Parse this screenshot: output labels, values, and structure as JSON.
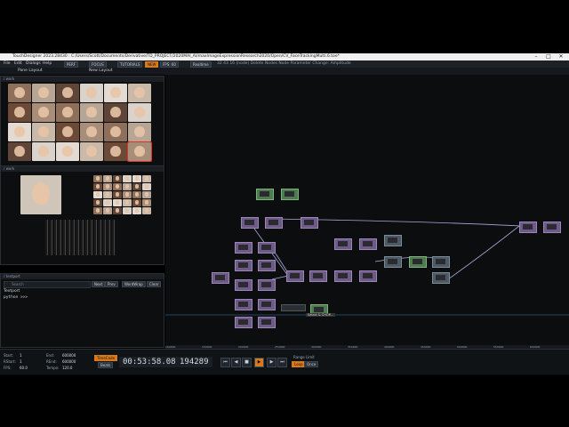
{
  "window": {
    "title": "TouchDesigner 2023.28430 : C:/Users/Scott/Documents/Derivative/TD_PROJECT/2020MAI_AI/maxImageExpressionResearch2020/Open/CV_FaceTrackingMulti.6.toe*",
    "min": "–",
    "max": "□",
    "close": "✕"
  },
  "menu": {
    "items": [
      "File",
      "Edit",
      "Dialogs",
      "Help"
    ],
    "pills": [
      "PERF",
      "FOCUS",
      "TUTORIALS",
      "NEW",
      "FPS: 60",
      "Realtime"
    ],
    "tools_text": "32 43 16 (node) Delete Nodes Node Parameter Change: Amplitude"
  },
  "pathbar": {
    "left_tab": "Pane Layout",
    "right_tab": "New Layout"
  },
  "panes": {
    "top_left_header": "/ work",
    "mid_left_header": "/ work",
    "big_header": "/ work",
    "network_header": "/ work"
  },
  "textport": {
    "header": "/ textport",
    "search_placeholder": "Search",
    "buttons": [
      "Next",
      "Prev",
      "WordWrap",
      "Clear"
    ],
    "title": "Textport",
    "line1": "python >>>"
  },
  "timeline": {
    "rows": [
      {
        "label": "Start:",
        "value": "1"
      },
      {
        "label": "End:",
        "value": "600000"
      },
      {
        "label": "RStart:",
        "value": "1"
      },
      {
        "label": "REnd:",
        "value": "600000"
      },
      {
        "label": "FPS:",
        "value": "60.0"
      },
      {
        "label": "Tempo:",
        "value": "120.0"
      }
    ],
    "timecode_label": "TimeCode",
    "beats_label": "Beats",
    "timecode": "00:53:58.08",
    "frame": "194289",
    "range_limit": "Range Limit",
    "loop": "Loop",
    "once": "Once",
    "ticks": [
      "100000",
      "150000",
      "200000",
      "250000",
      "300000",
      "350000",
      "400000",
      "450000",
      "500000",
      "550000",
      "600000"
    ]
  },
  "tooltip": "Select & CHOP..."
}
